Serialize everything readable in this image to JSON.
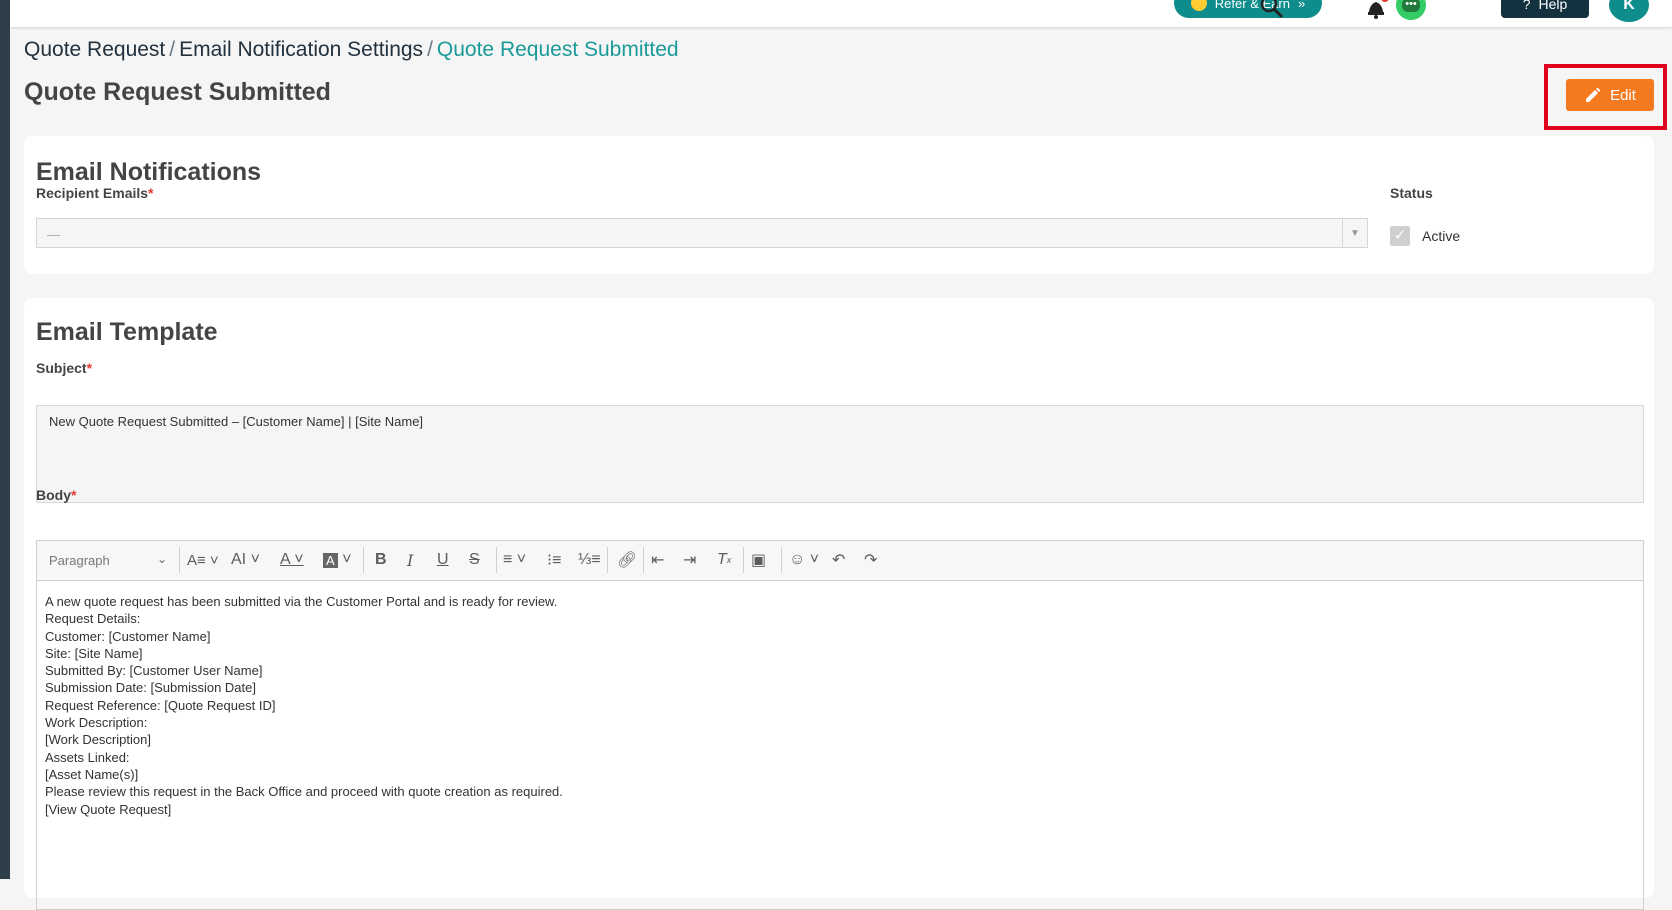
{
  "topbar": {
    "refer_label": "Refer & Earn",
    "help_label": "Help",
    "avatar_initial": "K",
    "icons": [
      "search-icon",
      "chat-icon",
      "bell-icon"
    ]
  },
  "breadcrumb": {
    "items": [
      "Quote Request",
      "Email Notification Settings",
      "Quote Request Submitted"
    ],
    "separator": "/"
  },
  "page": {
    "title": "Quote Request Submitted",
    "edit_label": "Edit"
  },
  "notifications": {
    "title": "Email Notifications",
    "recipient_label": "Recipient Emails",
    "required_mark": "*",
    "recipient_value": "—",
    "status_label": "Status",
    "status_value": "Active",
    "status_checked": true
  },
  "template": {
    "title": "Email Template",
    "subject_label": "Subject",
    "subject_value": "New Quote Request Submitted – [Customer Name] | [Site Name]",
    "body_label": "Body",
    "paragraph_style": "Paragraph",
    "body_lines": [
      "A new quote request has been submitted via the Customer Portal and is ready for review.",
      "Request Details:",
      "Customer: [Customer Name]",
      "Site: [Site Name]",
      "Submitted By: [Customer User Name]",
      "Submission Date: [Submission Date]",
      "Request Reference: [Quote Request ID]",
      "Work Description:",
      "[Work Description]",
      "Assets Linked:",
      "[Asset Name(s)]",
      "Please review this request in the Back Office and proceed with quote creation as required.",
      "[View Quote Request]"
    ]
  },
  "colors": {
    "accent": "#1a9a99",
    "edit": "#f57a1f",
    "highlight": "#e0001b"
  }
}
